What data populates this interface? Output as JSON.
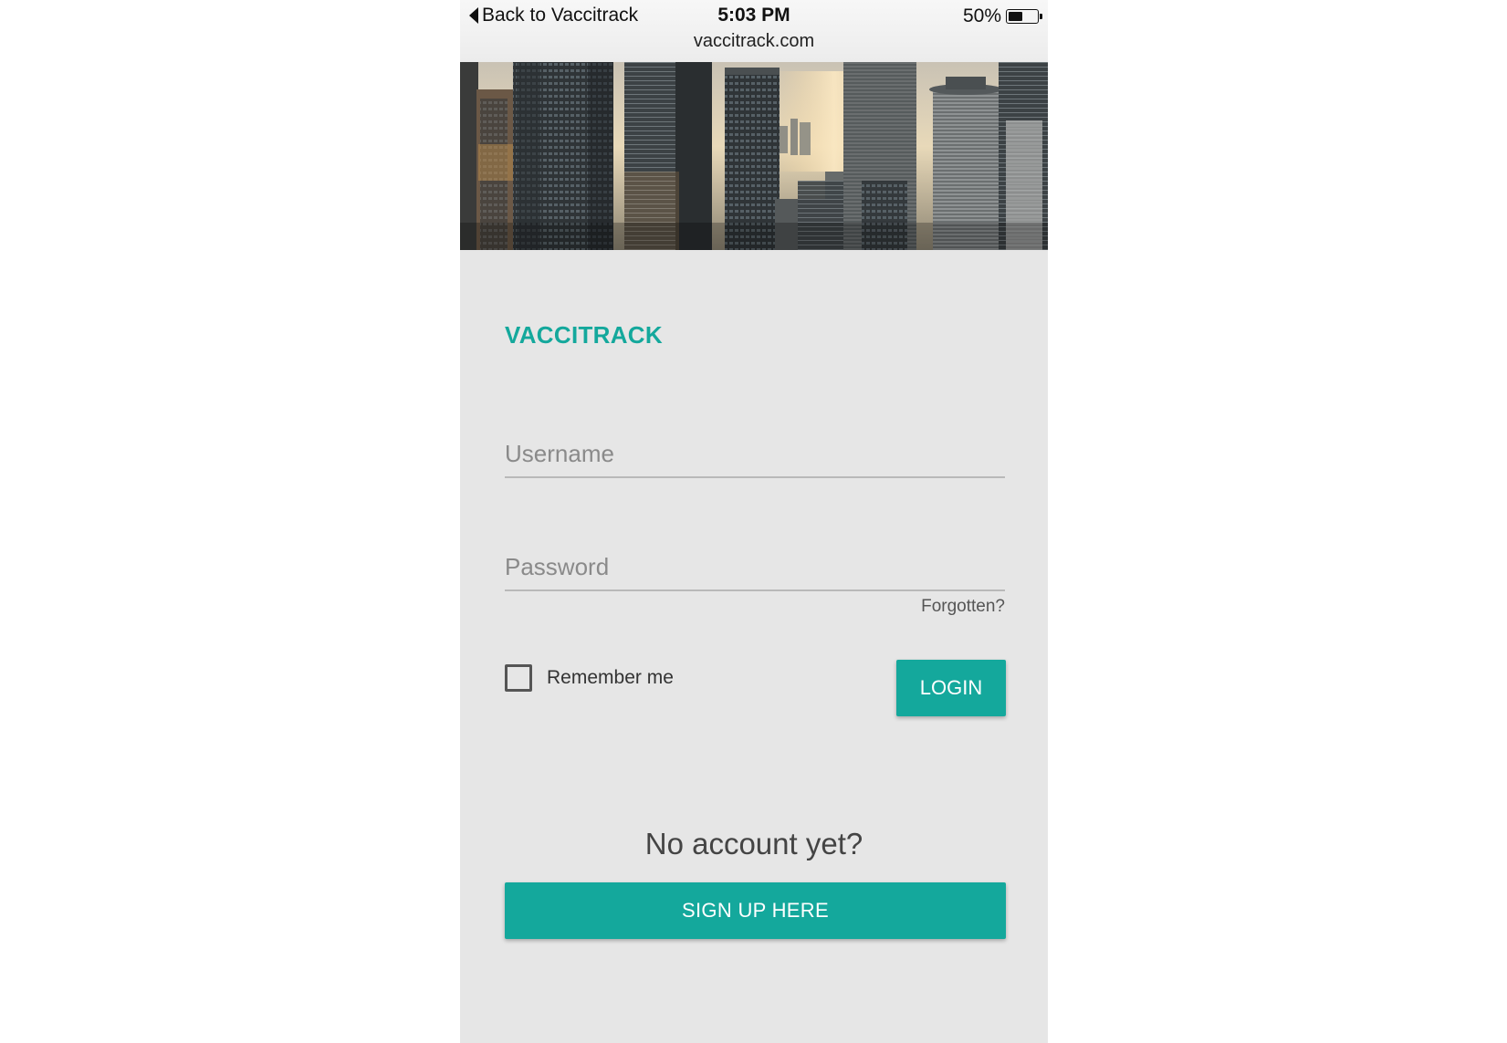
{
  "status_bar": {
    "back_label": "Back to Vaccitrack",
    "time": "5:03 PM",
    "battery_text": "50%",
    "battery_level": 0.5,
    "url": "vaccitrack.com"
  },
  "hero": {
    "icon": "city-skyline-photo"
  },
  "login_form": {
    "brand": "VACCITRACK",
    "username_placeholder": "Username",
    "username_value": "",
    "password_placeholder": "Password",
    "password_value": "",
    "forgot_label": "Forgotten?",
    "remember_label": "Remember me",
    "remember_checked": false,
    "login_label": "LOGIN"
  },
  "signup": {
    "prompt": "No account yet?",
    "button_label": "SIGN UP HERE"
  },
  "colors": {
    "accent": "#14a89c",
    "page_bg": "#e6e6e6"
  }
}
